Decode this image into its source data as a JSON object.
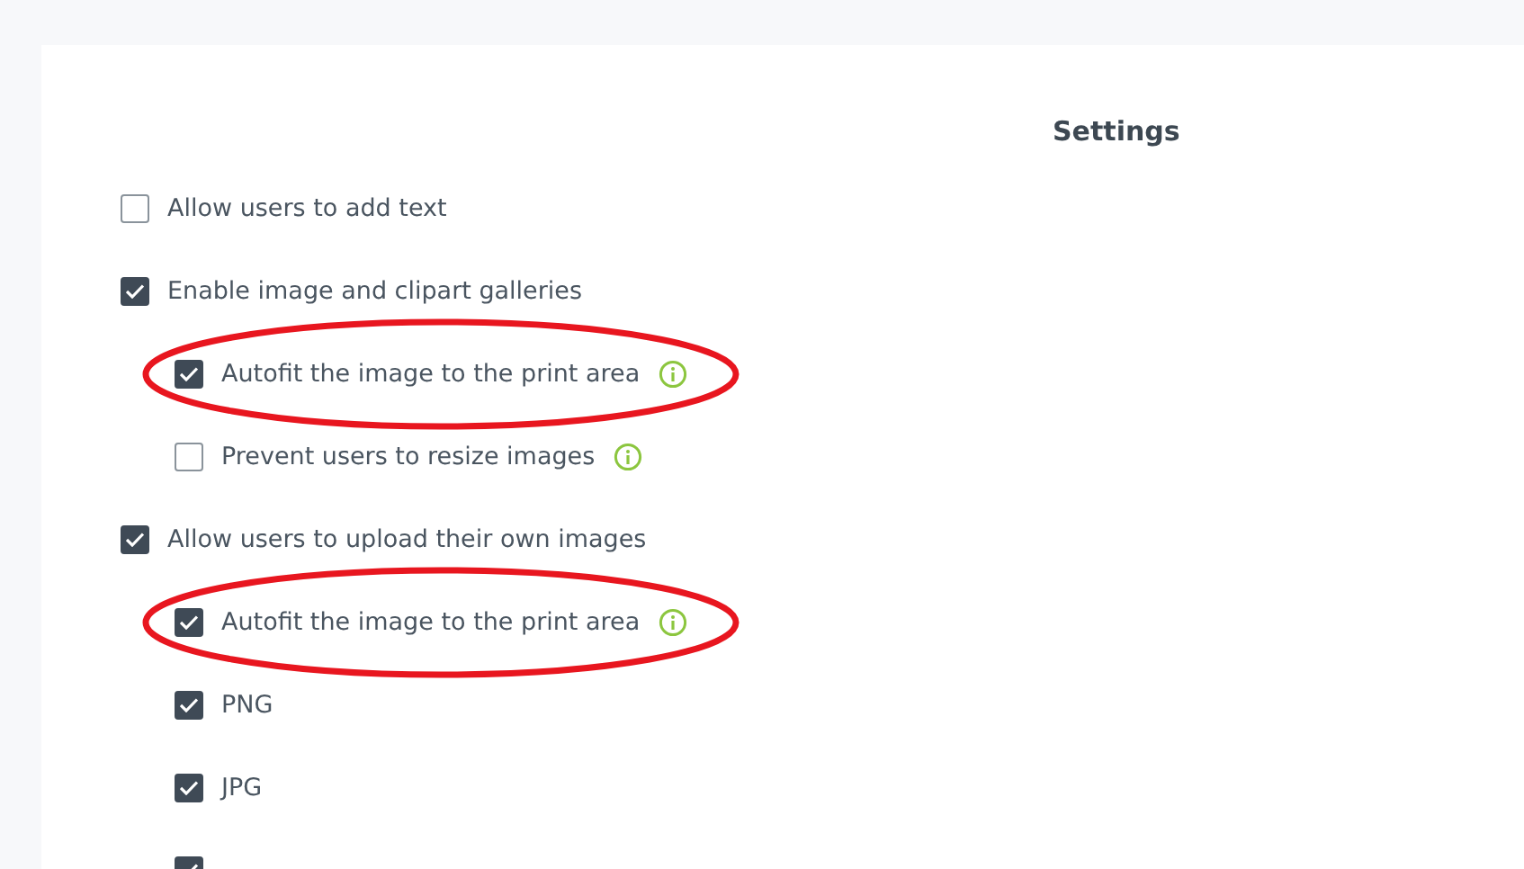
{
  "title": "Settings",
  "options": [
    {
      "label": "Allow users to add text",
      "checked": false
    },
    {
      "label": "Enable image and clipart galleries",
      "checked": true,
      "children": [
        {
          "label": "Autofit the image to the print area",
          "checked": true,
          "info": true,
          "highlighted": true
        },
        {
          "label": "Prevent users to resize images",
          "checked": false,
          "info": true,
          "highlighted": false
        }
      ]
    },
    {
      "label": "Allow users to upload their own images",
      "checked": true,
      "children": [
        {
          "label": "Autofit the image to the print area",
          "checked": true,
          "info": true,
          "highlighted": true
        },
        {
          "label": "PNG",
          "checked": true,
          "info": false,
          "highlighted": false
        },
        {
          "label": "JPG",
          "checked": true,
          "info": false,
          "highlighted": false
        },
        {
          "checked": true,
          "info": false,
          "highlighted": false
        }
      ]
    }
  ]
}
